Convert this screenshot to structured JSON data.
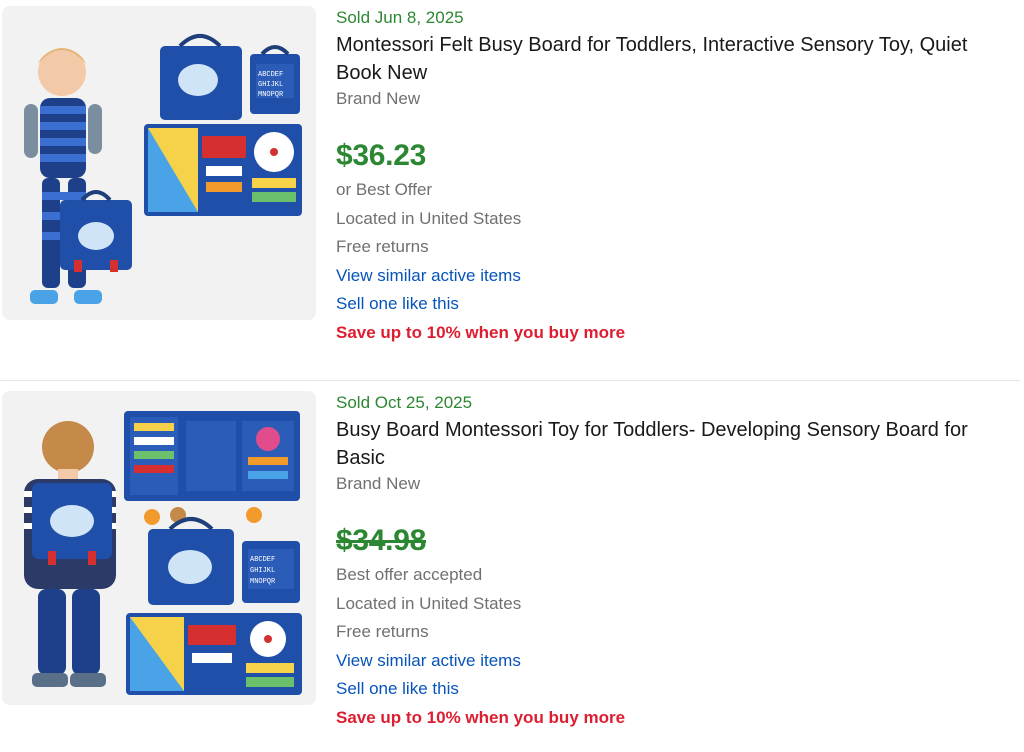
{
  "listings": [
    {
      "sold_date": "Sold Jun 8, 2025",
      "title": "Montessori Felt Busy Board for Toddlers, Interactive Sensory Toy, Quiet Book New",
      "condition": "Brand New",
      "price": "$36.23",
      "price_struck": false,
      "offer_text": "or Best Offer",
      "location": "Located in United States",
      "returns": "Free returns",
      "view_similar": "View similar active items",
      "sell_one": "Sell one like this",
      "promo": "Save up to 10% when you buy more",
      "image_alt": "toddler with blue felt busy board bag"
    },
    {
      "sold_date": "Sold Oct 25, 2025",
      "title": "Busy Board Montessori Toy for Toddlers- Developing Sensory Board for Basic",
      "condition": "Brand New",
      "price": "$34.98",
      "price_struck": true,
      "offer_text": "Best offer accepted",
      "location": "Located in United States",
      "returns": "Free returns",
      "view_similar": "View similar active items",
      "sell_one": "Sell one like this",
      "promo": "Save up to 10% when you buy more",
      "image_alt": "child wearing blue felt busy board backpack"
    }
  ],
  "colors": {
    "sold_green": "#2c8732",
    "link_blue": "#0654ba",
    "promo_red": "#dd1e31",
    "meta_gray": "#707070"
  }
}
